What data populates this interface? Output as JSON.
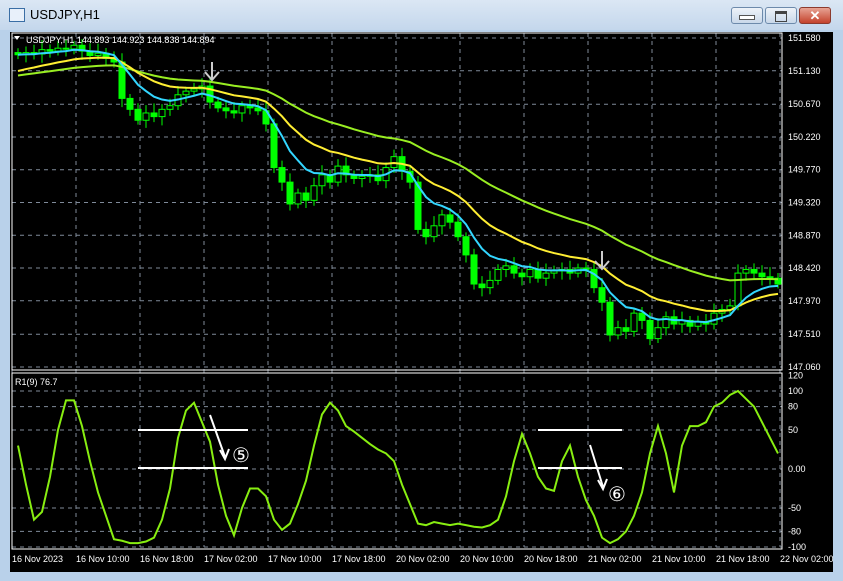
{
  "window": {
    "title": "USDJPY,H1",
    "minimize": "—",
    "close": "✕"
  },
  "chart": {
    "header": "USDJPY,H1  144.893 144.923 144.838 144.894",
    "symbol_menu_icon": "triangle-down-icon",
    "price_labels": [
      "151.580",
      "151.130",
      "150.670",
      "150.220",
      "149.770",
      "149.320",
      "148.870",
      "148.420",
      "147.970",
      "147.510",
      "147.060"
    ],
    "time_labels": [
      "16 Nov 2023",
      "16 Nov 10:00",
      "16 Nov 18:00",
      "17 Nov 02:00",
      "17 Nov 10:00",
      "17 Nov 18:00",
      "20 Nov 02:00",
      "20 Nov 10:00",
      "20 Nov 18:00",
      "21 Nov 02:00",
      "21 Nov 10:00",
      "21 Nov 18:00",
      "22 Nov 02:00"
    ],
    "indicator_label": "R1(9) 76.7",
    "indicator_levels": [
      "120",
      "100",
      "80",
      "50",
      "0.00",
      "-50",
      "-80",
      "-100"
    ],
    "annotations": [
      "⑤",
      "⑥"
    ],
    "colors": {
      "bull": "#00ff00",
      "bear": "#00ff00",
      "ema_fast": "#33d6ff",
      "ema_mid": "#ffee33",
      "ma_slow": "#99ee22",
      "osc": "#88ee11",
      "grid": "#7f8a99"
    }
  },
  "chart_data": {
    "type": "candlestick",
    "ylim": [
      147.06,
      151.58
    ],
    "closes": [
      151.35,
      151.38,
      151.36,
      151.42,
      151.4,
      151.44,
      151.43,
      151.48,
      151.4,
      151.34,
      151.37,
      151.3,
      151.25,
      150.75,
      150.6,
      150.45,
      150.55,
      150.5,
      150.6,
      150.65,
      150.8,
      150.85,
      150.88,
      150.92,
      150.7,
      150.62,
      150.58,
      150.55,
      150.65,
      150.62,
      150.58,
      150.4,
      149.8,
      149.6,
      149.3,
      149.45,
      149.35,
      149.55,
      149.7,
      149.6,
      149.82,
      149.7,
      149.65,
      149.68,
      149.7,
      149.62,
      149.8,
      149.95,
      149.75,
      149.6,
      148.95,
      148.85,
      149.0,
      149.15,
      149.05,
      148.85,
      148.6,
      148.2,
      148.15,
      148.25,
      148.4,
      148.45,
      148.35,
      148.3,
      148.4,
      148.28,
      148.35,
      148.38,
      148.4,
      148.35,
      148.42,
      148.4,
      148.15,
      147.95,
      147.5,
      147.6,
      147.55,
      147.8,
      147.7,
      147.45,
      147.6,
      147.75,
      147.65,
      147.7,
      147.62,
      147.68,
      147.65,
      147.8,
      147.85,
      147.9,
      148.35,
      148.4,
      148.35,
      148.3,
      148.28,
      148.2
    ],
    "oscillator": [
      30,
      -20,
      -65,
      -55,
      -10,
      50,
      88,
      88,
      55,
      10,
      -30,
      -60,
      -90,
      -92,
      -95,
      -95,
      -93,
      -88,
      -65,
      -25,
      40,
      75,
      85,
      60,
      35,
      -20,
      -60,
      -85,
      -50,
      -25,
      -25,
      -35,
      -65,
      -78,
      -70,
      -45,
      -15,
      30,
      70,
      85,
      75,
      55,
      48,
      40,
      32,
      25,
      20,
      10,
      -20,
      -45,
      -70,
      -72,
      -68,
      -70,
      -72,
      -70,
      -72,
      -74,
      -75,
      -72,
      -65,
      -35,
      10,
      45,
      20,
      -10,
      -25,
      -28,
      10,
      30,
      -10,
      -40,
      -60,
      -88,
      -95,
      -90,
      -80,
      -60,
      -30,
      20,
      55,
      20,
      -30,
      30,
      55,
      55,
      60,
      80,
      85,
      95,
      100,
      90,
      80,
      60,
      40,
      20
    ],
    "oscillator_ylim": [
      -100,
      120
    ]
  }
}
